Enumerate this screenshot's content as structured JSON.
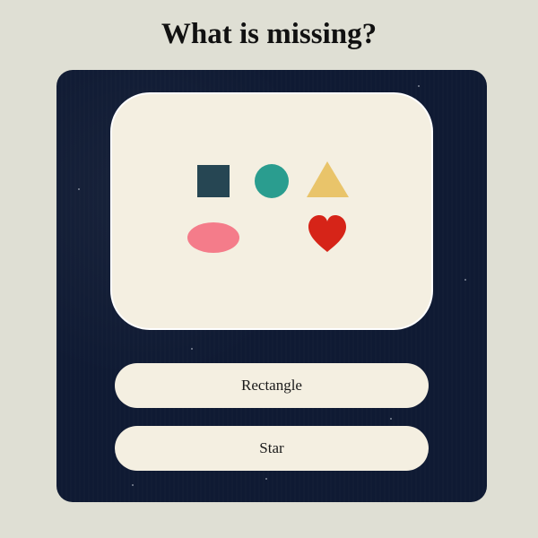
{
  "page": {
    "background": "#dfdfd4"
  },
  "question": {
    "title": "What is missing?"
  },
  "card": {
    "background": "#0f1a33",
    "panel_background": "#f4efe1"
  },
  "shapes": [
    {
      "name": "square",
      "color": "#264653"
    },
    {
      "name": "circle",
      "color": "#2a9d8f"
    },
    {
      "name": "triangle",
      "color": "#e9c46a"
    },
    {
      "name": "oval",
      "color": "#f47c8a"
    },
    {
      "name": "heart",
      "color": "#d62418"
    }
  ],
  "answers": [
    {
      "label": "Rectangle"
    },
    {
      "label": "Star"
    }
  ]
}
